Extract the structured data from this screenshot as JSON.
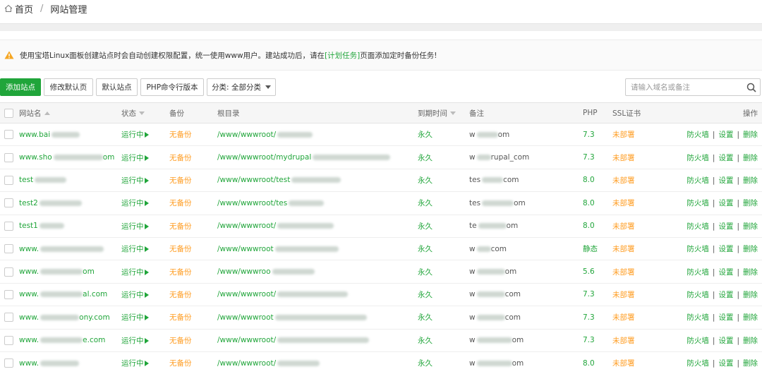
{
  "breadcrumb": {
    "home": "首页",
    "separator": "/",
    "current": "网站管理"
  },
  "notice": {
    "before": "使用宝塔Linux面板创建站点时会自动创建权限配置，统一使用www用户。建站成功后，请在",
    "link": "[计划任务]",
    "after": "页面添加定时备份任务!"
  },
  "toolbar": {
    "add_site": "添加站点",
    "modify_default_page": "修改默认页",
    "default_site": "默认站点",
    "php_cli_version": "PHP命令行版本",
    "category": "分类: 全部分类",
    "search_placeholder": "请输入域名或备注"
  },
  "columns": {
    "name": "网站名",
    "status": "状态",
    "backup": "备份",
    "root": "根目录",
    "expire": "到期时间",
    "remark": "备注",
    "php": "PHP",
    "ssl": "SSL证书",
    "actions": "操作"
  },
  "action_labels": {
    "firewall": "防火墙",
    "settings": "设置",
    "delete": "删除",
    "separator": "|"
  },
  "colors": {
    "accent": "#20a53a",
    "warning": "#ff9d23"
  },
  "rows": [
    {
      "name": "www.bai",
      "status": "运行中",
      "backup": "无备份",
      "root": "/www/wwwroot/",
      "expire": "永久",
      "remark_start": "w",
      "remark_end": "om",
      "php": "7.3",
      "ssl": "未部署"
    },
    {
      "name": "www.sho",
      "name_end": "om",
      "status": "运行中",
      "backup": "无备份",
      "root": "/www/wwwroot/mydrupal",
      "expire": "永久",
      "remark_start": "w",
      "remark_end": "rupal_com",
      "php": "7.3",
      "ssl": "未部署"
    },
    {
      "name": "test",
      "status": "运行中",
      "backup": "无备份",
      "root": "/www/wwwroot/test",
      "expire": "永久",
      "remark_start": "tes",
      "remark_end": "com",
      "php": "8.0",
      "ssl": "未部署"
    },
    {
      "name": "test2",
      "status": "运行中",
      "backup": "无备份",
      "root": "/www/wwwroot/tes",
      "expire": "永久",
      "remark_start": "tes",
      "remark_end": "om",
      "php": "8.0",
      "ssl": "未部署"
    },
    {
      "name": "test1",
      "status": "运行中",
      "backup": "无备份",
      "root": "/www/wwwroot/",
      "expire": "永久",
      "remark_start": "te",
      "remark_end": "om",
      "php": "8.0",
      "ssl": "未部署"
    },
    {
      "name": "www.",
      "status": "运行中",
      "backup": "无备份",
      "root": "/www/wwwroot",
      "expire": "永久",
      "remark_start": "w",
      "remark_end": "com",
      "php": "静态",
      "ssl": "未部署"
    },
    {
      "name": "www.",
      "name_end": "om",
      "status": "运行中",
      "backup": "无备份",
      "root": "/www/wwwroo",
      "expire": "永久",
      "remark_start": "w",
      "remark_end": "om",
      "php": "5.6",
      "ssl": "未部署"
    },
    {
      "name": "www.",
      "name_end": "al.com",
      "status": "运行中",
      "backup": "无备份",
      "root": "/www/wwwroot/",
      "expire": "永久",
      "remark_start": "w",
      "remark_end": "com",
      "php": "7.3",
      "ssl": "未部署"
    },
    {
      "name": "www.",
      "name_end": "ony.com",
      "status": "运行中",
      "backup": "无备份",
      "root": "/www/wwwroot",
      "expire": "永久",
      "remark_start": "w",
      "remark_end": "com",
      "php": "7.3",
      "ssl": "未部署"
    },
    {
      "name": "www.",
      "name_end": "e.com",
      "status": "运行中",
      "backup": "无备份",
      "root": "/www/wwwroot/",
      "expire": "永久",
      "remark_start": "w",
      "remark_end": "om",
      "php": "7.3",
      "ssl": "未部署"
    },
    {
      "name": "www.",
      "status": "运行中",
      "backup": "无备份",
      "root": "/www/wwwroot/",
      "expire": "永久",
      "remark_start": "w",
      "remark_end": "om",
      "php": "8.0",
      "ssl": "未部署"
    }
  ]
}
